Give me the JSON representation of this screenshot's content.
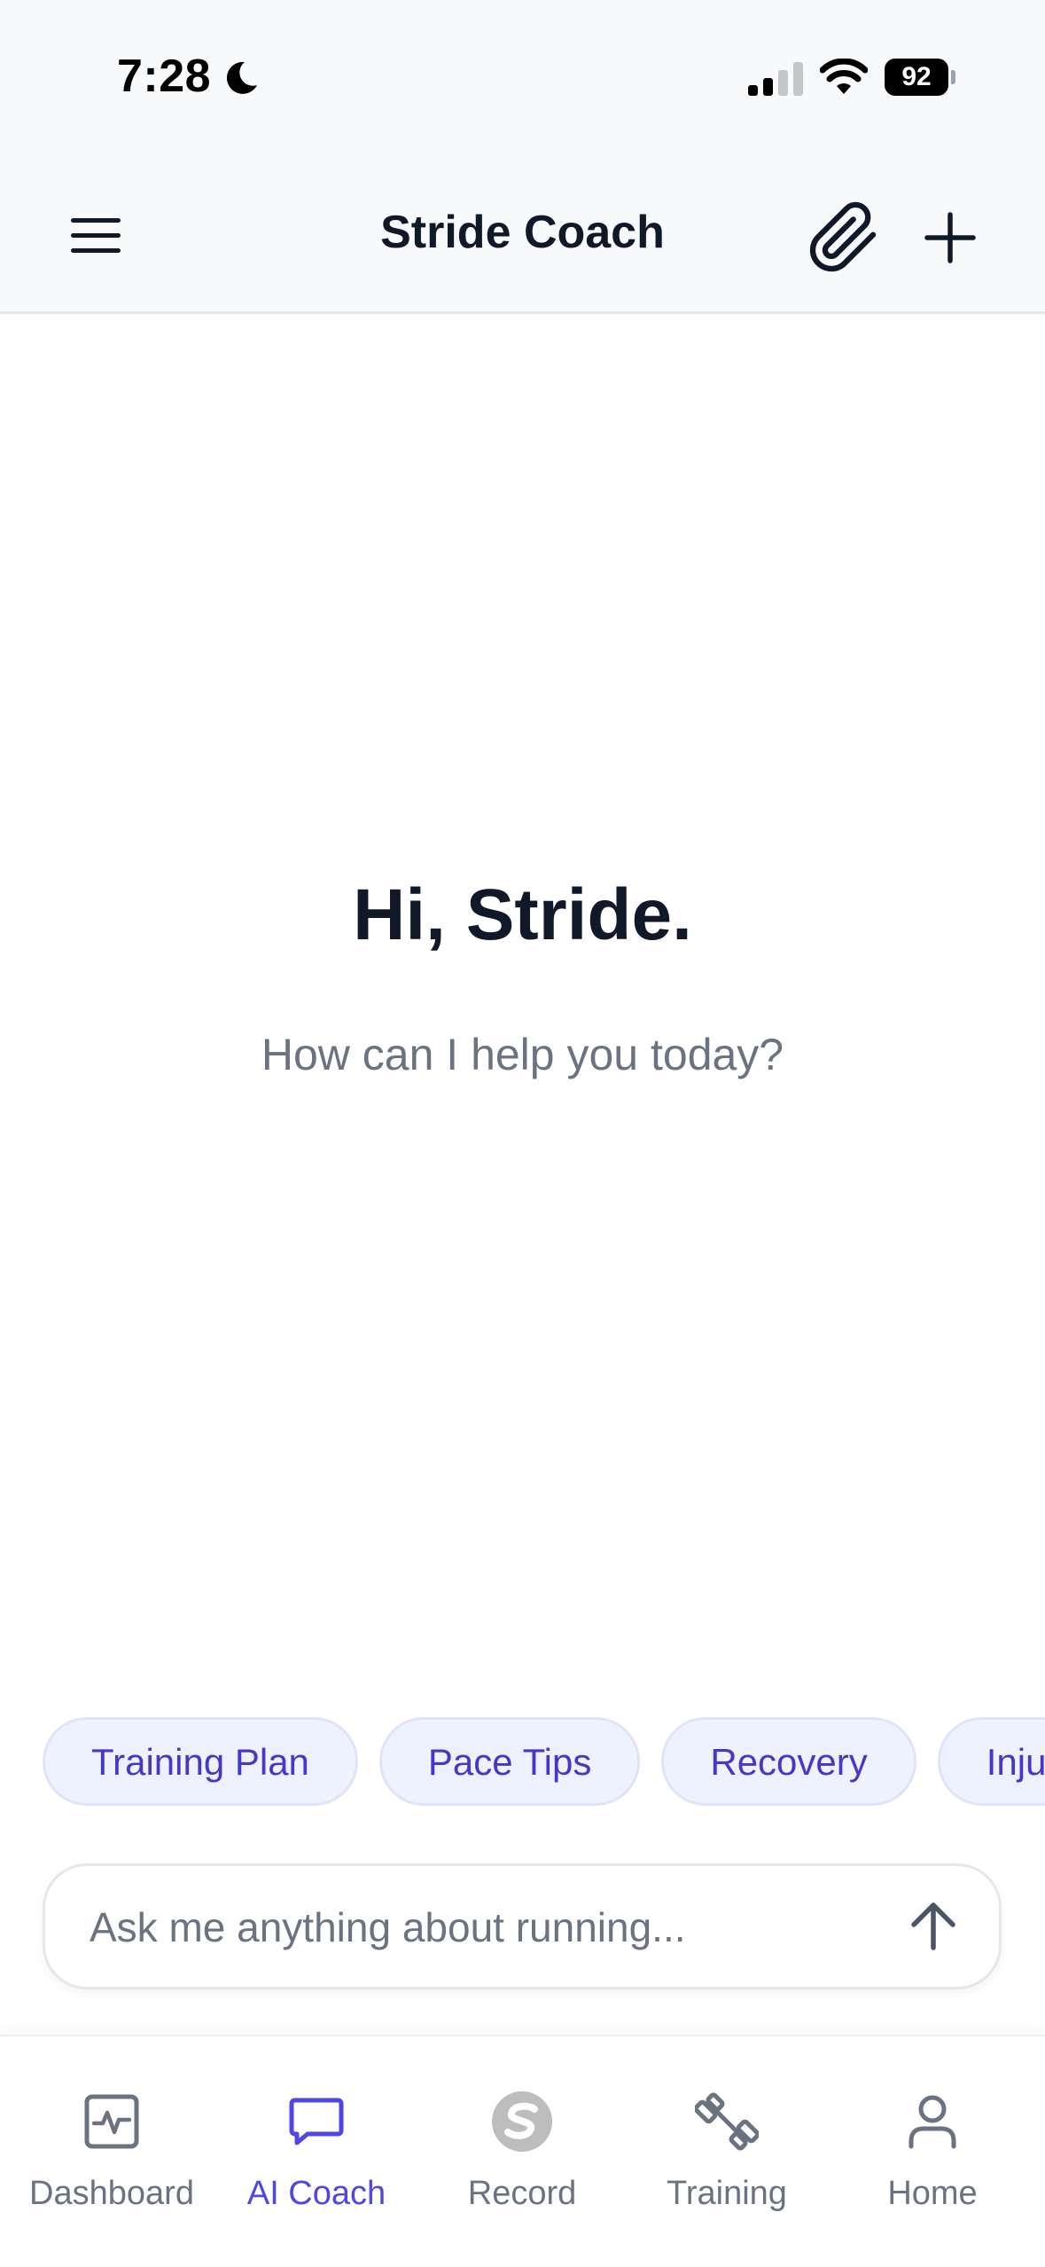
{
  "status_bar": {
    "time": "7:28",
    "battery": "92"
  },
  "header": {
    "title": "Stride Coach"
  },
  "main": {
    "greeting": "Hi, Stride.",
    "subtitle": "How can I help you today?"
  },
  "chips": [
    {
      "label": "Training Plan"
    },
    {
      "label": "Pace Tips"
    },
    {
      "label": "Recovery"
    },
    {
      "label": "Injury Prevention"
    }
  ],
  "composer": {
    "placeholder": "Ask me anything about running...",
    "value": ""
  },
  "tabs": [
    {
      "label": "Dashboard",
      "icon": "activity-icon"
    },
    {
      "label": "AI Coach",
      "icon": "chat-icon",
      "active": true
    },
    {
      "label": "Record",
      "icon": "record-logo-icon"
    },
    {
      "label": "Training",
      "icon": "dumbbell-icon"
    },
    {
      "label": "Home",
      "icon": "user-icon"
    }
  ],
  "colors": {
    "accent": "#4f46e5",
    "chip_bg": "#eef2ff",
    "chip_text": "#4338ca",
    "header_bg": "#f8f9fb",
    "muted": "#6b7280"
  }
}
